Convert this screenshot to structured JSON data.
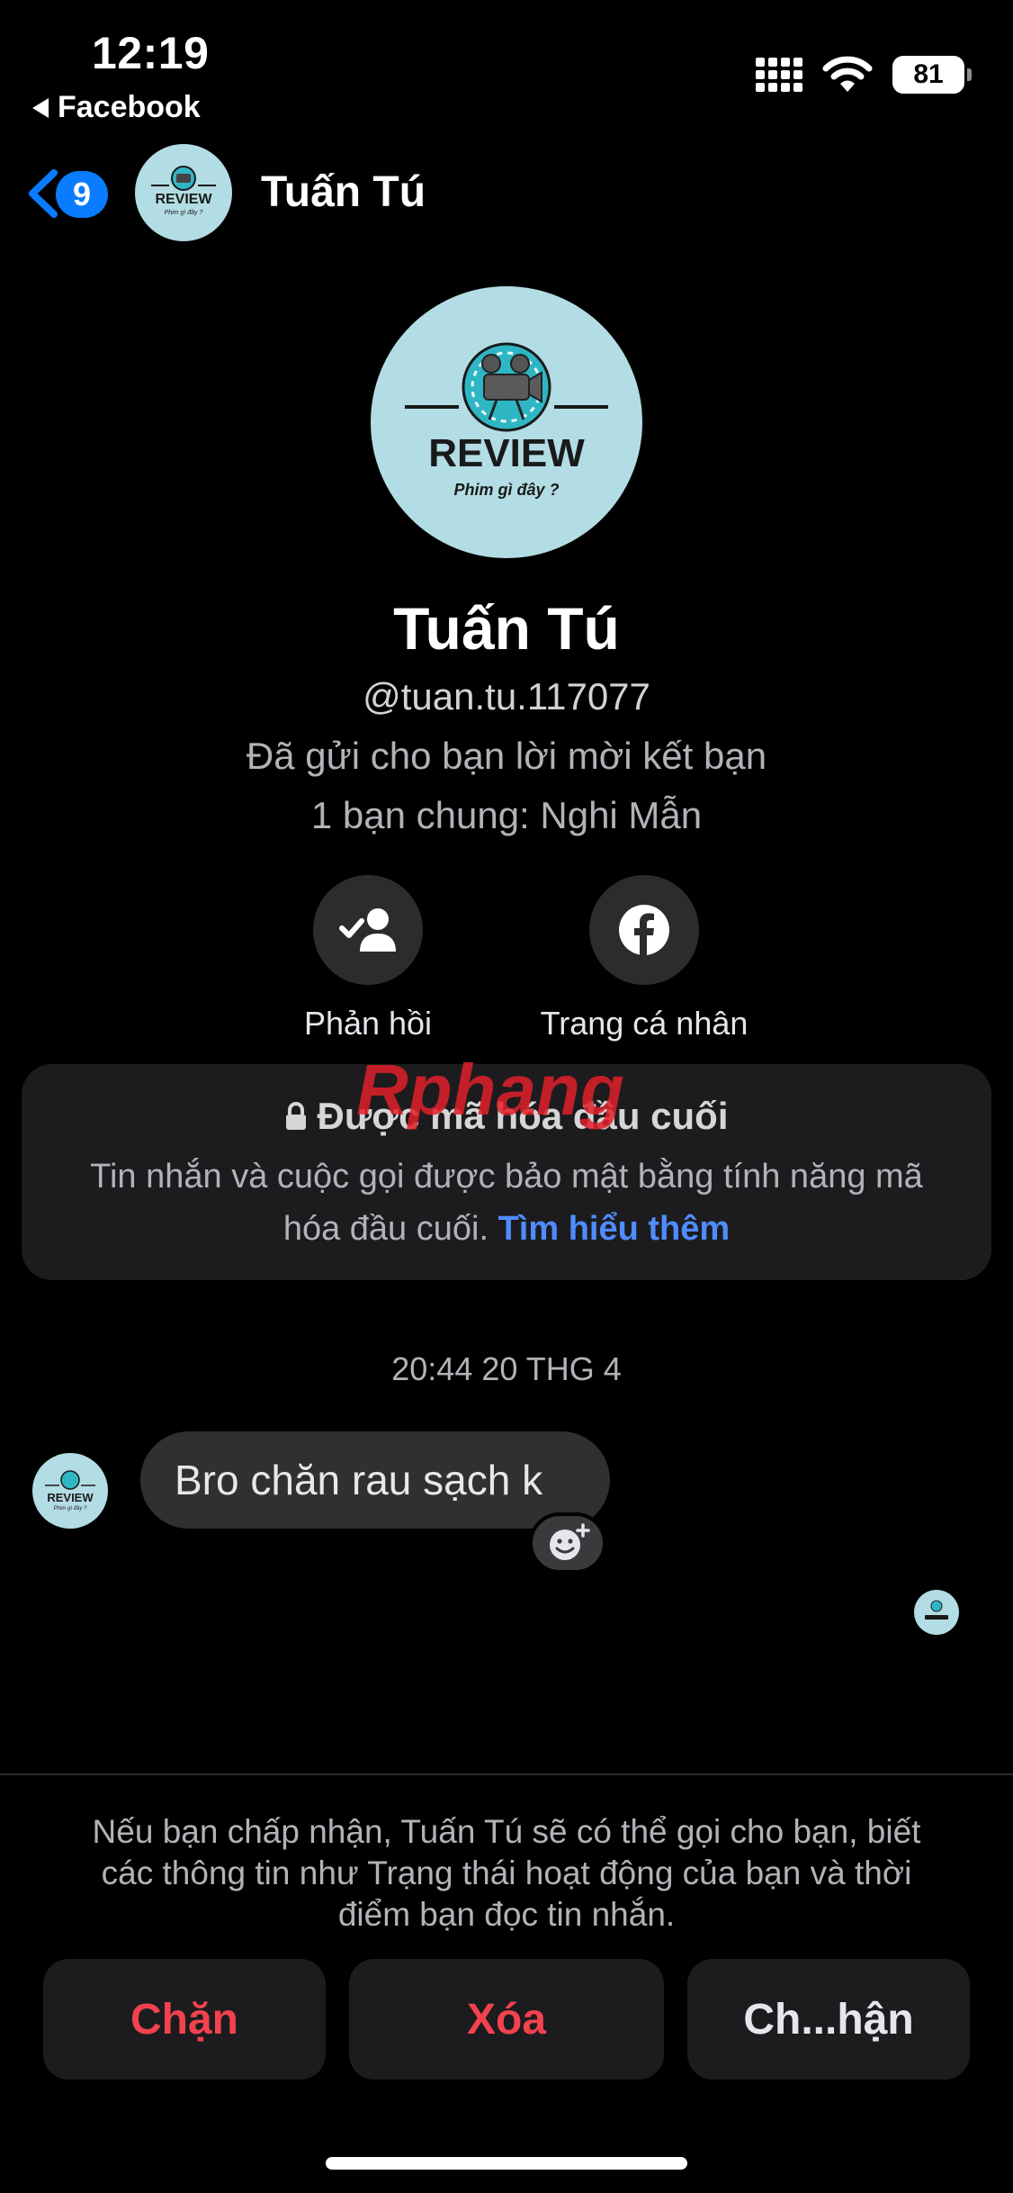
{
  "status_bar": {
    "time": "12:19",
    "back_app": "Facebook",
    "battery": "81"
  },
  "header": {
    "badge_count": "9",
    "title": "Tuấn Tú"
  },
  "avatar": {
    "text_main": "REVIEW",
    "text_sub": "Phim gì đây ?"
  },
  "profile": {
    "name": "Tuấn Tú",
    "handle": "@tuan.tu.117077",
    "request_status": "Đã gửi cho bạn lời mời kết bạn",
    "mutual_friends": "1 bạn chung: Nghi Mẫn"
  },
  "actions": [
    {
      "label": "Phản hồi",
      "icon": "person-check-icon"
    },
    {
      "label": "Trang cá nhân",
      "icon": "facebook-icon"
    }
  ],
  "encryption": {
    "title": "Được mã hóa đầu cuối",
    "body": "Tin nhắn và cuộc gọi được bảo mật bằng tính năng mã hóa đầu cuối.",
    "link": "Tìm hiểu thêm"
  },
  "watermark": "Rphang",
  "conversation": {
    "timestamp": "20:44 20 THG 4",
    "messages": [
      {
        "text": "Bro chăn rau sạch k"
      }
    ]
  },
  "request_footer": {
    "disclaimer": "Nếu bạn chấp nhận, Tuấn Tú sẽ có thể gọi cho bạn, biết các thông tin như Trạng thái hoạt động của bạn và thời điểm bạn đọc tin nhắn.",
    "block_label": "Chặn",
    "delete_label": "Xóa",
    "accept_label": "Ch...hận"
  },
  "colors": {
    "accent_blue": "#0a7cff",
    "link_blue": "#4f8cff",
    "danger_red": "#f3424e",
    "avatar_bg": "#b3dde4"
  }
}
